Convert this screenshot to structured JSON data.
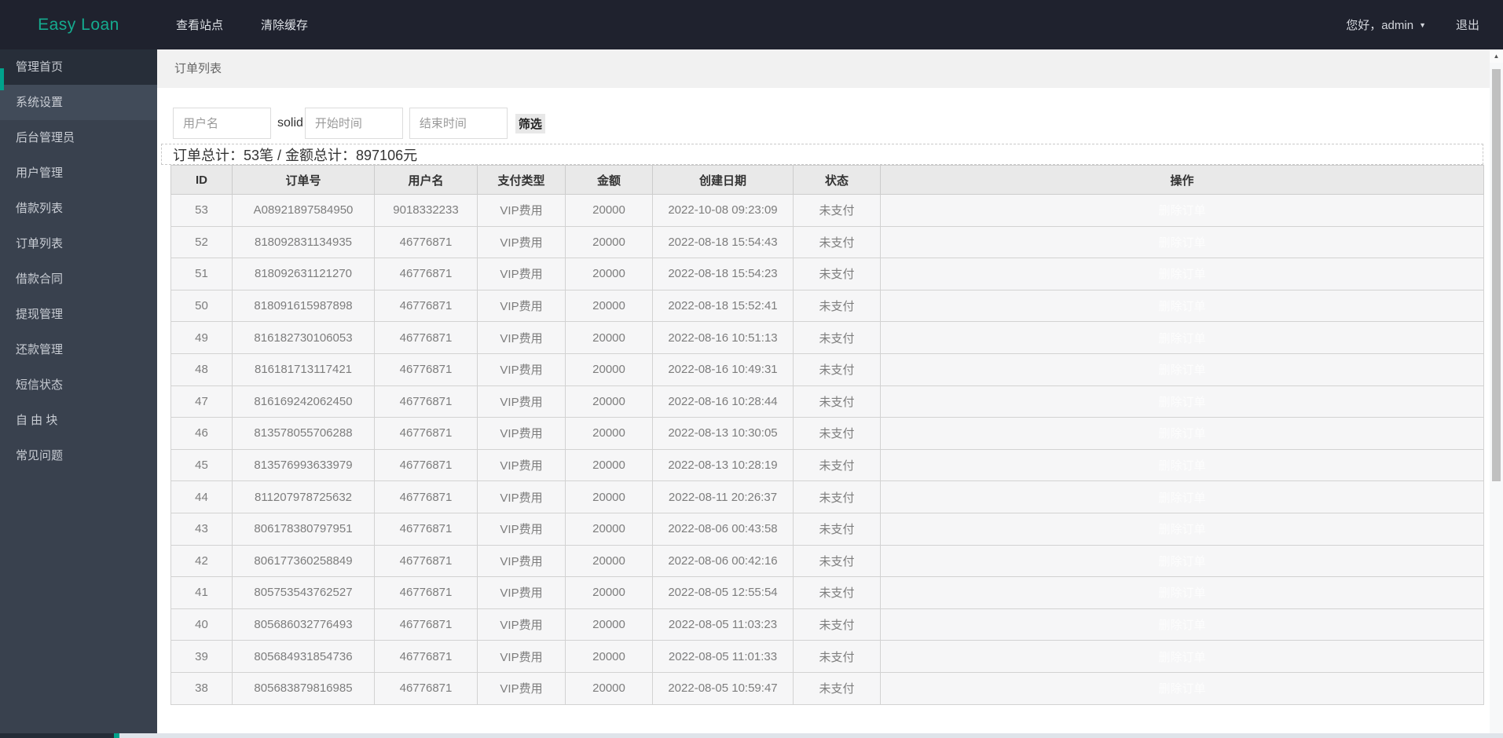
{
  "topbar": {
    "brand": "Easy Loan",
    "menu": [
      {
        "label": "查看站点"
      },
      {
        "label": "清除缓存"
      }
    ],
    "greeting": "您好，admin",
    "logout_label": "退出"
  },
  "icons": {
    "caret_down": "▼",
    "scroll_up_arrow": "▲"
  },
  "sidebar": {
    "items": [
      {
        "label": "管理首页",
        "state": "active"
      },
      {
        "label": "系统设置",
        "state": "alt"
      },
      {
        "label": "后台管理员",
        "state": ""
      },
      {
        "label": "用户管理",
        "state": ""
      },
      {
        "label": "借款列表",
        "state": ""
      },
      {
        "label": "订单列表",
        "state": ""
      },
      {
        "label": "借款合同",
        "state": ""
      },
      {
        "label": "提现管理",
        "state": ""
      },
      {
        "label": "还款管理",
        "state": ""
      },
      {
        "label": "短信状态",
        "state": ""
      },
      {
        "label": "自 由 块",
        "state": ""
      },
      {
        "label": "常见问题",
        "state": ""
      }
    ]
  },
  "breadcrumb": {
    "title": "订单列表"
  },
  "filter": {
    "username_placeholder": "用户名",
    "solid_text": "solid",
    "start_placeholder": "开始时间",
    "end_placeholder": "结束时间",
    "submit_label": "筛选"
  },
  "summary": {
    "text": "订单总计：53笔 / 金额总计：897106元"
  },
  "table": {
    "headers": [
      "ID",
      "订单号",
      "用户名",
      "支付类型",
      "金额",
      "创建日期",
      "状态",
      "操作"
    ],
    "op_label": "删除订单",
    "rows": [
      {
        "id": "53",
        "order_no": "A08921897584950",
        "username": "9018332233",
        "pay_type": "VIP费用",
        "amount": "20000",
        "created": "2022-10-08 09:23:09",
        "status": "未支付"
      },
      {
        "id": "52",
        "order_no": "818092831134935",
        "username": "46776871",
        "pay_type": "VIP费用",
        "amount": "20000",
        "created": "2022-08-18 15:54:43",
        "status": "未支付"
      },
      {
        "id": "51",
        "order_no": "818092631121270",
        "username": "46776871",
        "pay_type": "VIP费用",
        "amount": "20000",
        "created": "2022-08-18 15:54:23",
        "status": "未支付"
      },
      {
        "id": "50",
        "order_no": "818091615987898",
        "username": "46776871",
        "pay_type": "VIP费用",
        "amount": "20000",
        "created": "2022-08-18 15:52:41",
        "status": "未支付"
      },
      {
        "id": "49",
        "order_no": "816182730106053",
        "username": "46776871",
        "pay_type": "VIP费用",
        "amount": "20000",
        "created": "2022-08-16 10:51:13",
        "status": "未支付"
      },
      {
        "id": "48",
        "order_no": "816181713117421",
        "username": "46776871",
        "pay_type": "VIP费用",
        "amount": "20000",
        "created": "2022-08-16 10:49:31",
        "status": "未支付"
      },
      {
        "id": "47",
        "order_no": "816169242062450",
        "username": "46776871",
        "pay_type": "VIP费用",
        "amount": "20000",
        "created": "2022-08-16 10:28:44",
        "status": "未支付"
      },
      {
        "id": "46",
        "order_no": "813578055706288",
        "username": "46776871",
        "pay_type": "VIP费用",
        "amount": "20000",
        "created": "2022-08-13 10:30:05",
        "status": "未支付"
      },
      {
        "id": "45",
        "order_no": "813576993633979",
        "username": "46776871",
        "pay_type": "VIP费用",
        "amount": "20000",
        "created": "2022-08-13 10:28:19",
        "status": "未支付"
      },
      {
        "id": "44",
        "order_no": "811207978725632",
        "username": "46776871",
        "pay_type": "VIP费用",
        "amount": "20000",
        "created": "2022-08-11 20:26:37",
        "status": "未支付"
      },
      {
        "id": "43",
        "order_no": "806178380797951",
        "username": "46776871",
        "pay_type": "VIP费用",
        "amount": "20000",
        "created": "2022-08-06 00:43:58",
        "status": "未支付"
      },
      {
        "id": "42",
        "order_no": "806177360258849",
        "username": "46776871",
        "pay_type": "VIP费用",
        "amount": "20000",
        "created": "2022-08-06 00:42:16",
        "status": "未支付"
      },
      {
        "id": "41",
        "order_no": "805753543762527",
        "username": "46776871",
        "pay_type": "VIP费用",
        "amount": "20000",
        "created": "2022-08-05 12:55:54",
        "status": "未支付"
      },
      {
        "id": "40",
        "order_no": "805686032776493",
        "username": "46776871",
        "pay_type": "VIP费用",
        "amount": "20000",
        "created": "2022-08-05 11:03:23",
        "status": "未支付"
      },
      {
        "id": "39",
        "order_no": "805684931854736",
        "username": "46776871",
        "pay_type": "VIP费用",
        "amount": "20000",
        "created": "2022-08-05 11:01:33",
        "status": "未支付"
      },
      {
        "id": "38",
        "order_no": "805683879816985",
        "username": "46776871",
        "pay_type": "VIP费用",
        "amount": "20000",
        "created": "2022-08-05 10:59:47",
        "status": "未支付"
      }
    ]
  },
  "colors": {
    "topbar_bg": "#1f222e",
    "brand_teal": "#15ab8f",
    "sidebar_bg": "#39414e",
    "sidebar_active_bg": "#272e39",
    "accent_teal": "#00a28c",
    "breadcrumb_bg": "#f1f1f1",
    "table_header_bg": "#e9e9e9",
    "row_bg": "#f6f6f7",
    "status_red": "#e53935"
  }
}
